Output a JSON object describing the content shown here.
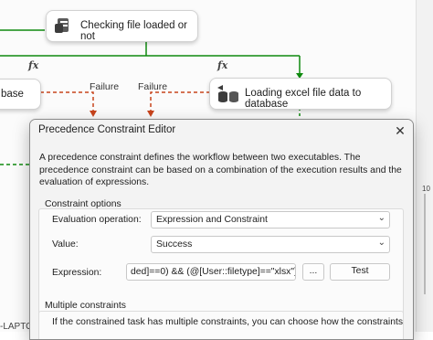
{
  "canvas": {
    "task_checking": "Checking file loaded or not",
    "task_loading": "Loading excel file data to database",
    "task_partial": "base",
    "fx_left": "fx",
    "fx_right": "fx",
    "failure_left": "Failure",
    "failure_right": "Failure",
    "bottom_left_text": "-LAPTO",
    "right_ruler_text": "10",
    "colors": {
      "success": "#0f8a0f",
      "failure": "#c8441c"
    }
  },
  "dialog": {
    "title": "Precedence Constraint Editor",
    "close_glyph": "✕",
    "description": "A precedence constraint defines the workflow between two executables. The precedence constraint can be based on a combination of the execution results and the evaluation of expressions.",
    "options": {
      "header": "Constraint options",
      "evaluation_label": "Evaluation operation:",
      "evaluation_value": "Expression and Constraint",
      "value_label": "Value:",
      "value_value": "Success",
      "expression_label": "Expression:",
      "expression_value": "ded]==0)  && (@[User::filetype]==\"xlsx\")",
      "ellipsis_label": "...",
      "test_label": "Test"
    },
    "multiple": {
      "header": "Multiple constraints",
      "text": "If the constrained task has multiple constraints, you can choose how the constraints"
    }
  }
}
